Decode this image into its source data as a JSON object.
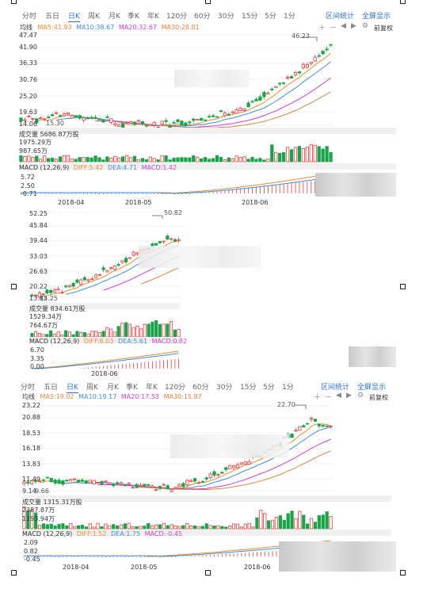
{
  "toolbar": {
    "tabs": [
      "分时",
      "五日",
      "日K",
      "周K",
      "月K",
      "季K",
      "年K",
      "120分",
      "60分",
      "30分",
      "15分",
      "5分",
      "1分"
    ],
    "range_stats": "区间统计",
    "fullscreen": "全屏显示",
    "adjust": "前复权"
  },
  "chart1": {
    "ma_title": "均线",
    "ma_labels": [
      "MA5:41.93",
      "MA10:38.67",
      "MA20:32.67",
      "MA30:28.81"
    ],
    "peak_label": "46.23",
    "low_label": "15.30",
    "price_ticks": [
      "47.47",
      "41.90",
      "36.33",
      "30.76",
      "25.20",
      "19.63",
      "14.06"
    ],
    "volume_title": "成交量 5686.87万股",
    "volume_ticks": [
      "1975.29万",
      "987.65万"
    ],
    "macd_title": "MACD (12,26,9)",
    "macd_diff": "DIFF:5.42",
    "macd_dea": "DEA:4.71",
    "macd_val": "MACD:1.42",
    "macd_ticks": [
      "5.72",
      "2.50",
      "-0.71"
    ],
    "date_ticks": [
      "2018-04",
      "2018-05",
      "2018-06"
    ]
  },
  "chart2": {
    "peak_label": "50.82",
    "price_ticks": [
      "52.25",
      "45.84",
      "39.44",
      "33.03",
      "26.63",
      "20.22",
      "13.82"
    ],
    "low_label": "15.25",
    "volume_title": "成交量 834.61万股",
    "volume_ticks": [
      "1529.34万",
      "764.67万"
    ],
    "macd_title": "MACD (12,26,9)",
    "macd_diff": "DIFF:6.03",
    "macd_dea": "DEA:5.61",
    "macd_val": "MACD:0.82",
    "macd_ticks": [
      "6.70",
      "3.35",
      "0.00"
    ],
    "date_ticks": [
      "2018-06"
    ]
  },
  "chart3": {
    "ma_title": "均线",
    "ma_labels": [
      "MA5:19.02",
      "MA10:19.17",
      "MA20:17.53",
      "MA30:15.87"
    ],
    "peak_label": "22.70",
    "low_label": "9.66",
    "price_ticks": [
      "23.22",
      "20.88",
      "18.53",
      "16.18",
      "13.83",
      "11.49",
      "9.14"
    ],
    "volume_title": "成交量 1315.31万股",
    "volume_ticks": [
      "2387.87万",
      "1193.94万"
    ],
    "macd_title": "MACD (12,26,9)",
    "macd_diff": "DIFF:1.52",
    "macd_dea": "DEA:1.75",
    "macd_val": "MACD:-0.45",
    "macd_ticks": [
      "2.09",
      "0.82",
      "-0.45"
    ],
    "date_ticks": [
      "2018-04",
      "2018-05",
      "2018-06"
    ]
  },
  "colors": {
    "up": "#e83b3b",
    "down": "#1aa34a",
    "ma5": "#ee8a2b",
    "ma10": "#3c8de0",
    "ma20": "#d23cd2",
    "ma30": "#e0833a",
    "accent": "#2c6fd6"
  },
  "chart_data": [
    {
      "type": "candlestick",
      "title": "均线",
      "x": [
        "2018-04",
        "2018-05",
        "2018-06"
      ],
      "ylim": [
        14.06,
        47.47
      ],
      "series": [
        {
          "name": "MA5",
          "last": 41.93
        },
        {
          "name": "MA10",
          "last": 38.67
        },
        {
          "name": "MA20",
          "last": 32.67
        },
        {
          "name": "MA30",
          "last": 28.81
        }
      ],
      "annotations": {
        "high": 46.23,
        "low": 15.3
      },
      "volume": {
        "total": "5686.87万股",
        "ticks": [
          "1975.29万",
          "987.65万"
        ]
      },
      "macd": {
        "DIFF": 5.42,
        "DEA": 4.71,
        "MACD": 1.42,
        "ylim": [
          -0.71,
          5.72
        ]
      }
    },
    {
      "type": "candlestick",
      "x": [
        "2018-06"
      ],
      "ylim": [
        13.82,
        52.25
      ],
      "annotations": {
        "high": 50.82,
        "low": 15.25
      },
      "volume": {
        "total": "834.61万股",
        "ticks": [
          "1529.34万",
          "764.67万"
        ]
      },
      "macd": {
        "DIFF": 6.03,
        "DEA": 5.61,
        "MACD": 0.82,
        "ylim": [
          0.0,
          6.7
        ]
      }
    },
    {
      "type": "candlestick",
      "title": "均线",
      "x": [
        "2018-04",
        "2018-05",
        "2018-06"
      ],
      "ylim": [
        9.14,
        23.22
      ],
      "series": [
        {
          "name": "MA5",
          "last": 19.02
        },
        {
          "name": "MA10",
          "last": 19.17
        },
        {
          "name": "MA20",
          "last": 17.53
        },
        {
          "name": "MA30",
          "last": 15.87
        }
      ],
      "annotations": {
        "high": 22.7,
        "low": 9.66
      },
      "volume": {
        "total": "1315.31万股",
        "ticks": [
          "2387.87万",
          "1193.94万"
        ]
      },
      "macd": {
        "DIFF": 1.52,
        "DEA": 1.75,
        "MACD": -0.45,
        "ylim": [
          -0.45,
          2.09
        ]
      }
    }
  ]
}
